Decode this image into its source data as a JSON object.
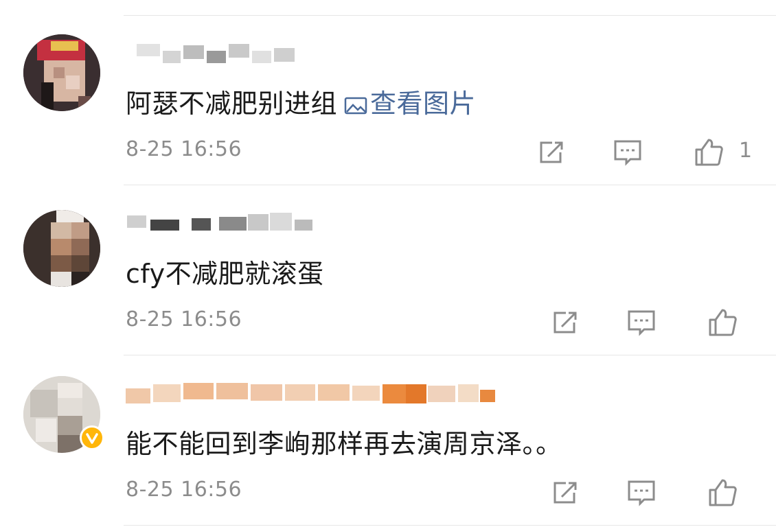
{
  "comments": [
    {
      "username": "",
      "text": "阿瑟不减肥别进组",
      "link_label": "查看图片",
      "time": "8-25 16:56",
      "like_count": "1",
      "avatar_icon": "user-avatar-icon"
    },
    {
      "username": "",
      "text": "cfy不减肥就滚蛋",
      "time": "8-25 16:56",
      "like_count": "",
      "avatar_icon": "user-avatar-icon"
    },
    {
      "username": "",
      "text": "能不能回到李峋那样再去演周京泽。。",
      "time": "8-25 16:56",
      "like_count": "",
      "avatar_icon": "user-avatar-icon",
      "verified_badge": true
    }
  ],
  "icons": {
    "repost": "repost-icon",
    "comment": "comment-icon",
    "like": "like-icon",
    "image": "image-icon"
  },
  "colors": {
    "text": "#1a1a1a",
    "meta": "#8c8c8c",
    "link": "#4a6a9a",
    "divider": "#e6e6e6",
    "verified": "#ffb60a",
    "username_orange": "#e8833a"
  }
}
